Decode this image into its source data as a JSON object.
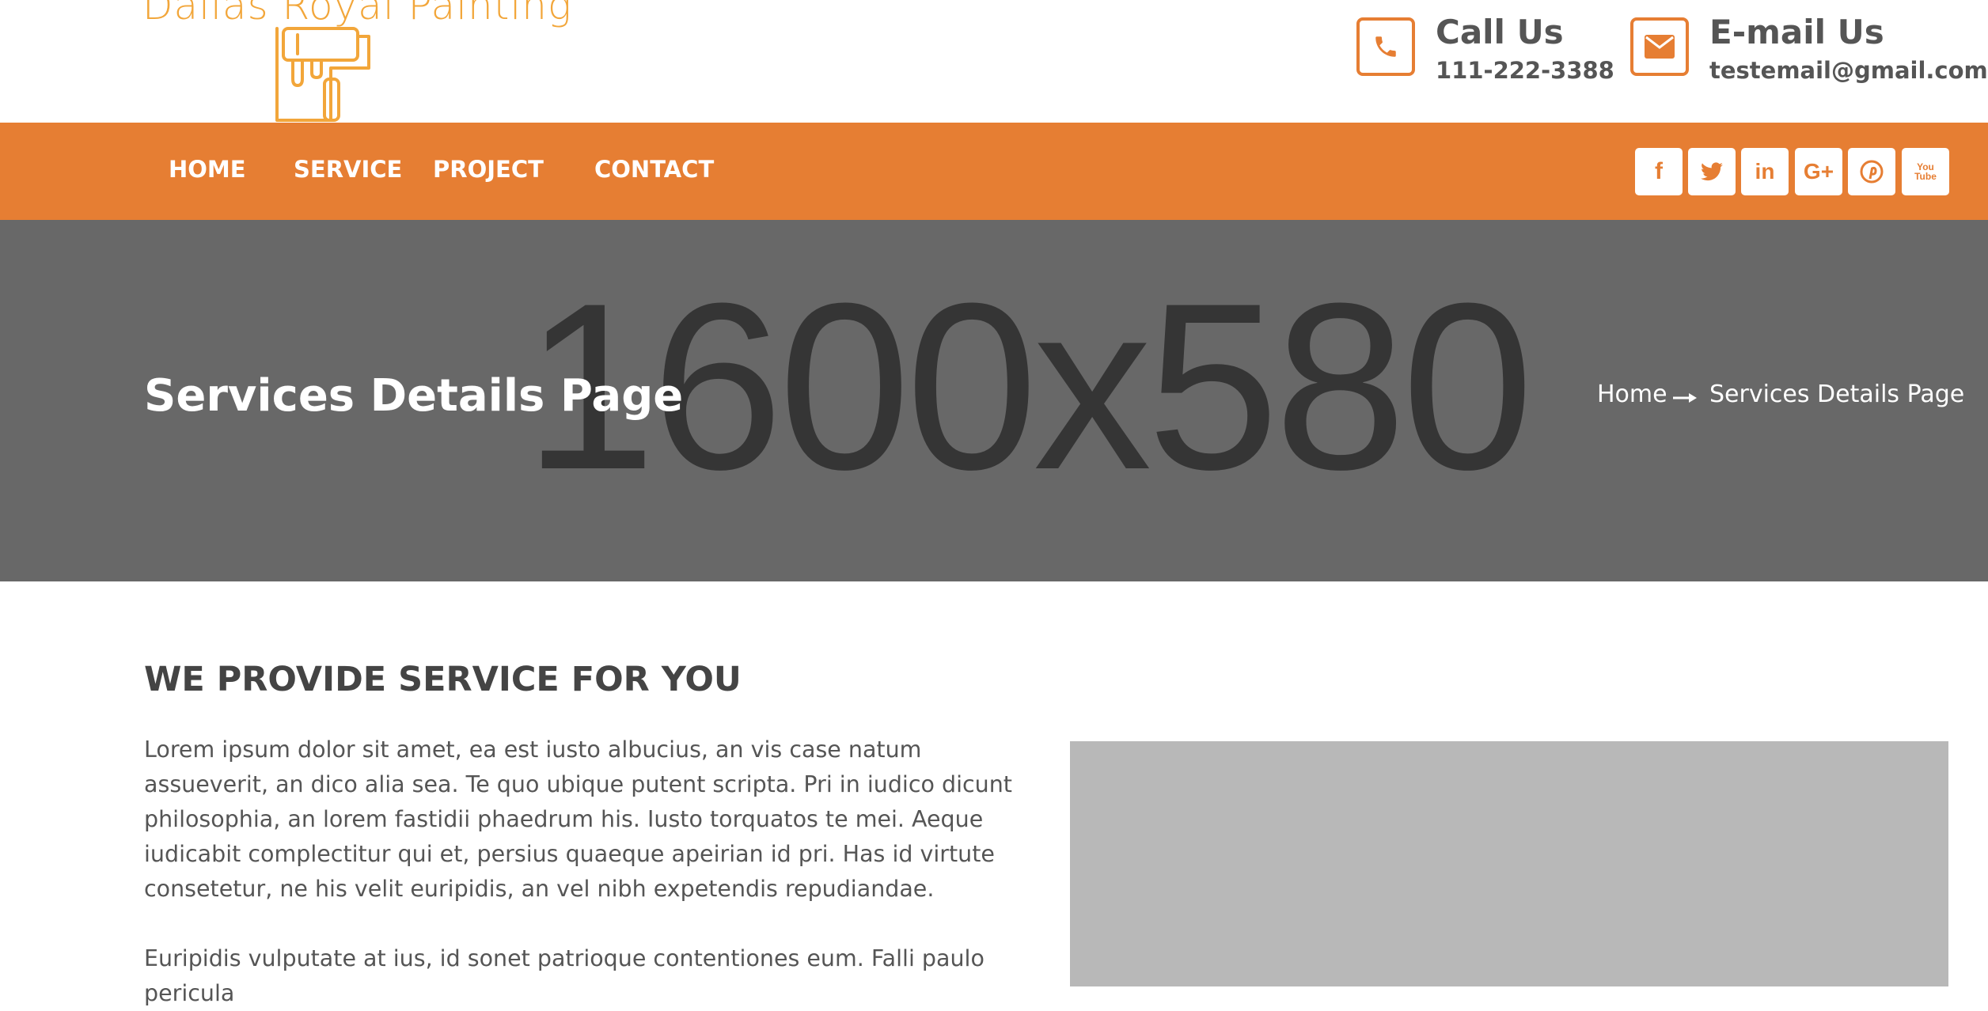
{
  "brand": {
    "name": "Dallas Royal Painting"
  },
  "contact": {
    "call": {
      "title": "Call Us",
      "value": "111-222-3388",
      "icon": "phone-icon"
    },
    "email": {
      "title": "E-mail Us",
      "value": "testemail@gmail.com",
      "icon": "envelope-icon"
    }
  },
  "nav": {
    "items": [
      {
        "label": "HOME"
      },
      {
        "label": "SERVICE"
      },
      {
        "label": "PROJECT"
      },
      {
        "label": "CONTACT"
      }
    ],
    "social": [
      {
        "icon": "facebook-icon",
        "glyph": "f"
      },
      {
        "icon": "twitter-icon",
        "glyph": "t"
      },
      {
        "icon": "linkedin-icon",
        "glyph": "in"
      },
      {
        "icon": "google-plus-icon",
        "glyph": "G+"
      },
      {
        "icon": "pinterest-icon",
        "glyph": "p"
      },
      {
        "icon": "youtube-icon",
        "glyph": "You Tube"
      }
    ]
  },
  "banner": {
    "placeholder": "1600x580",
    "title": "Services Details Page",
    "breadcrumb": {
      "home": "Home",
      "current": "Services Details Page"
    }
  },
  "content": {
    "heading": "WE PROVIDE SERVICE FOR YOU",
    "paragraph1": "Lorem ipsum dolor sit amet, ea est iusto albucius, an vis case natum assueverit, an dico alia sea. Te quo ubique putent scripta. Pri in iudico dicunt philosophia, an lorem fastidii phaedrum his. Iusto torquatos te mei. Aeque iudicabit complectitur qui et, persius quaeque apeirian id pri. Has id virtute consetetur, ne his velit euripidis, an vel nibh expetendis repudiandae.",
    "paragraph2": "Euripidis vulputate at ius, id sonet patrioque contentiones eum. Falli paulo pericula"
  },
  "colors": {
    "accent": "#e67e33",
    "logo": "#f2a63a",
    "banner": "#686868",
    "placeholder_text": "#353535",
    "image_box": "#b8b8b8"
  }
}
